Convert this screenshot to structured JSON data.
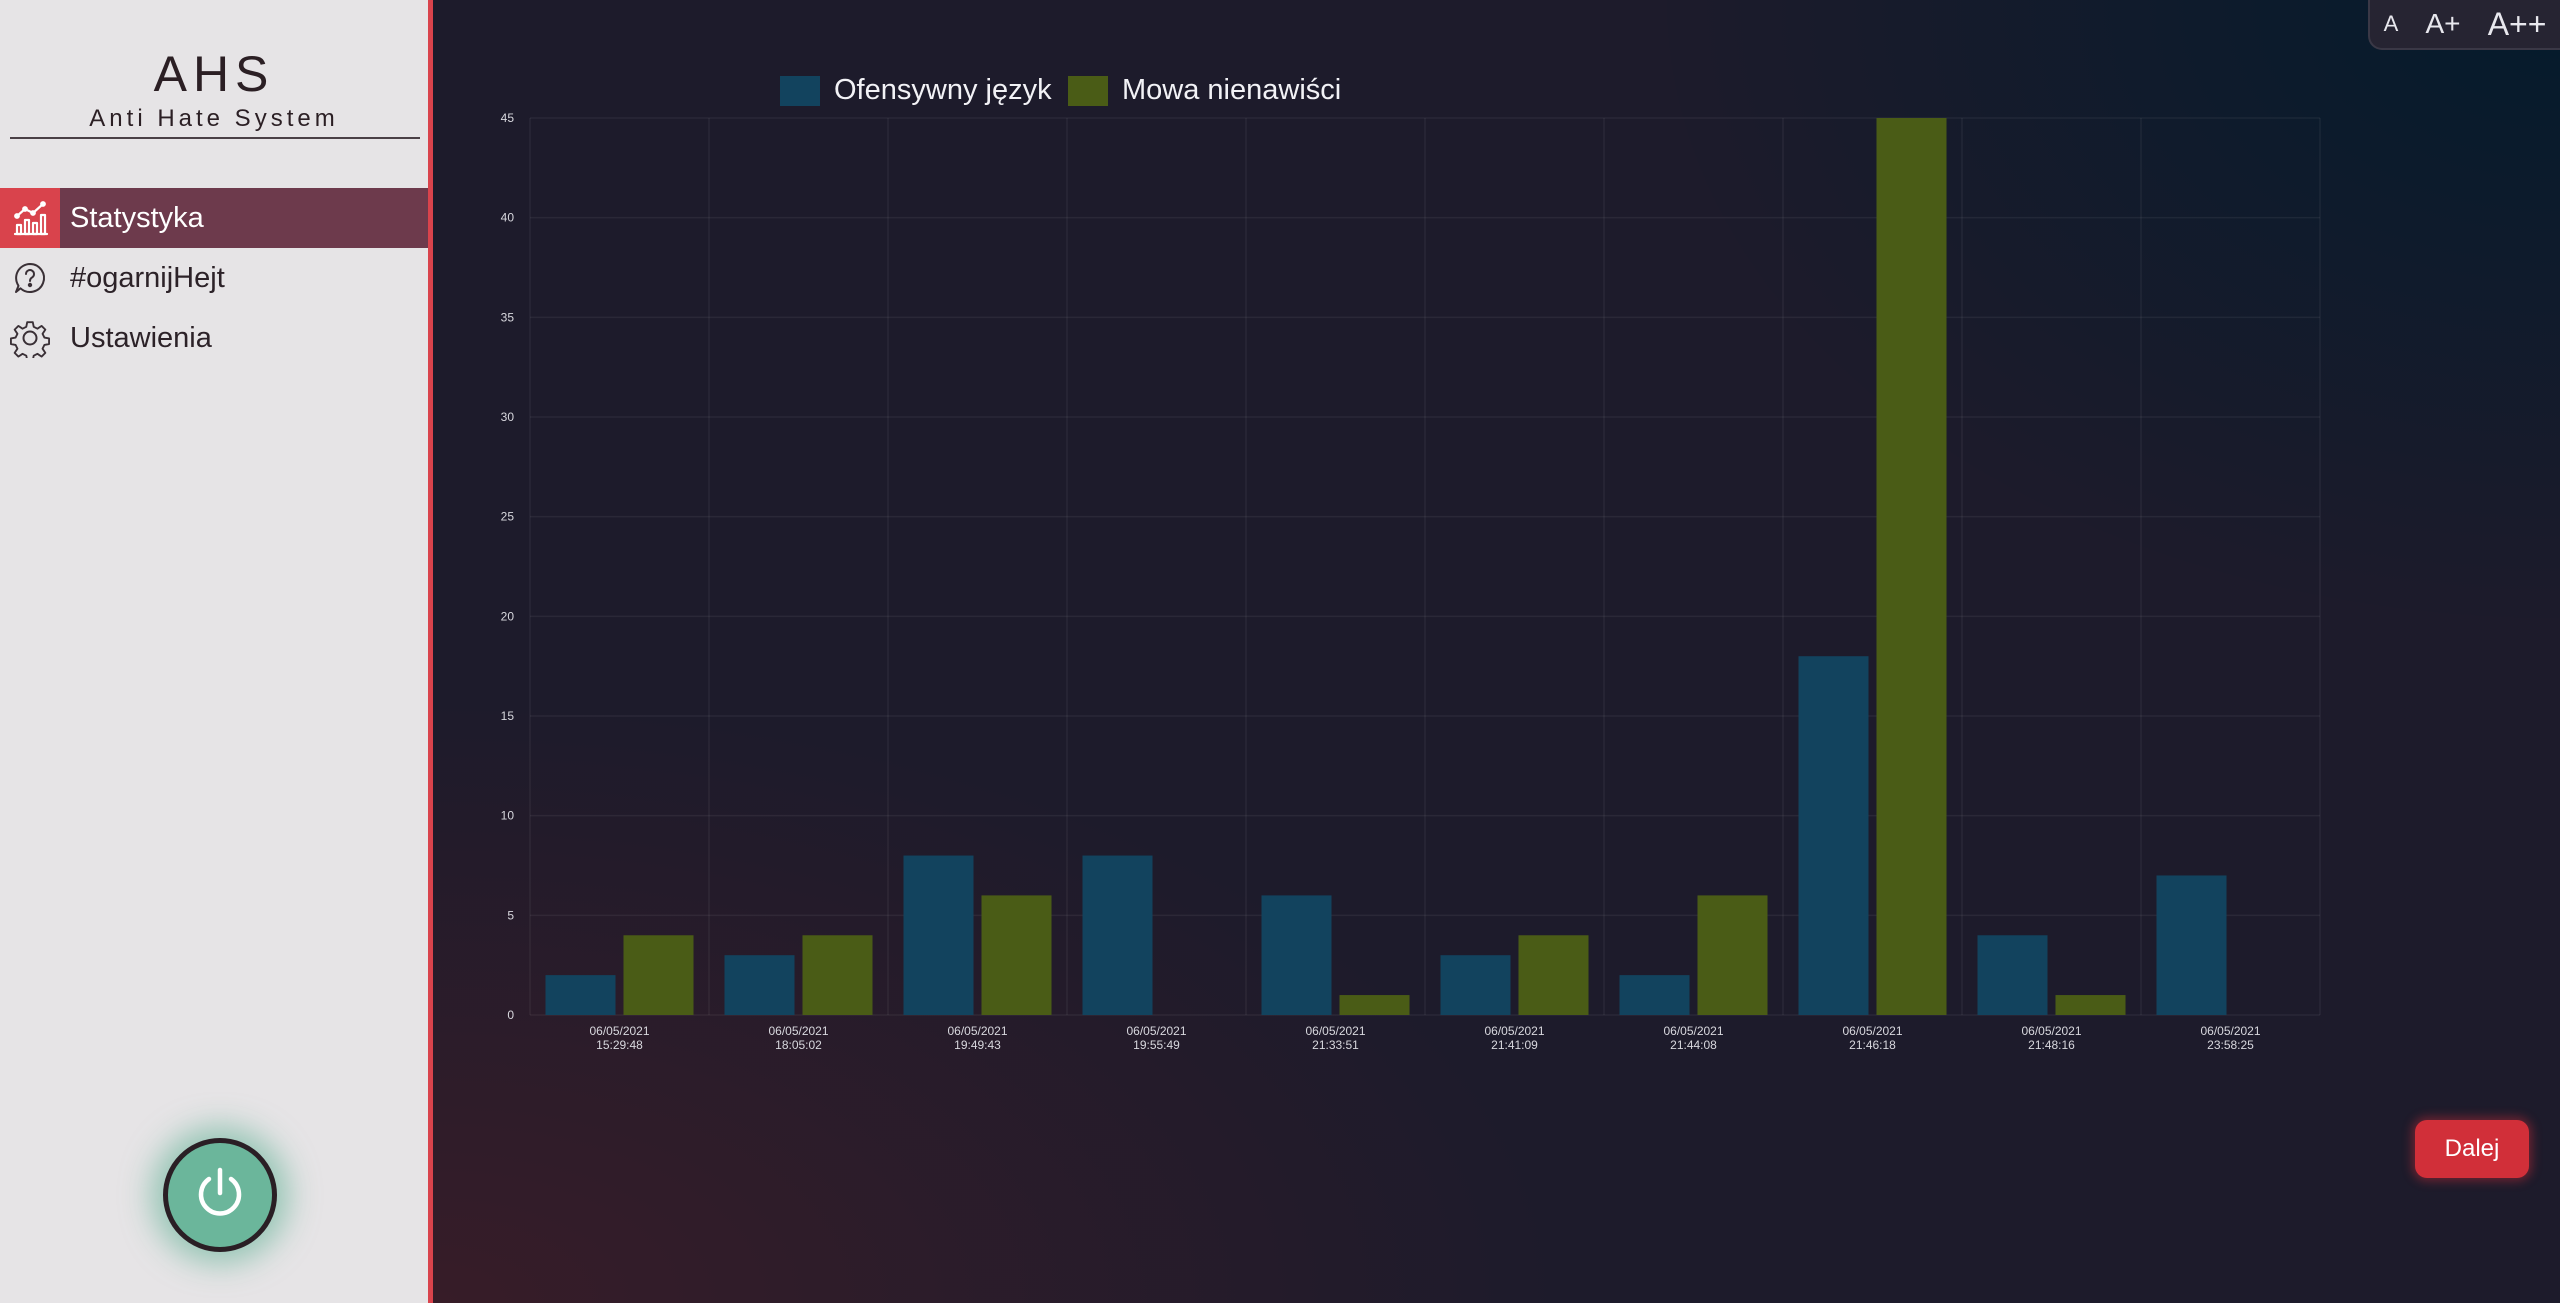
{
  "sidebar": {
    "logo_title": "AHS",
    "logo_subtitle": "Anti Hate System",
    "items": [
      {
        "label": "Statystyka",
        "icon": "chart-line-icon",
        "active": true
      },
      {
        "label": "#ogarnijHejt",
        "icon": "question-icon",
        "active": false
      },
      {
        "label": "Ustawienia",
        "icon": "gear-icon",
        "active": false
      }
    ],
    "power_icon": "power-icon"
  },
  "font_size": {
    "small": "A",
    "medium": "A+",
    "large": "A++"
  },
  "next_button": {
    "label": "Dalej"
  },
  "colors": {
    "accent": "#d9434c",
    "series_offensive": "#12435e",
    "series_hate": "#4a5c16",
    "power": "#6bb69b"
  },
  "chart_data": {
    "type": "bar",
    "categories": [
      [
        "06/05/2021",
        "15:29:48"
      ],
      [
        "06/05/2021",
        "18:05:02"
      ],
      [
        "06/05/2021",
        "19:49:43"
      ],
      [
        "06/05/2021",
        "19:55:49"
      ],
      [
        "06/05/2021",
        "21:33:51"
      ],
      [
        "06/05/2021",
        "21:41:09"
      ],
      [
        "06/05/2021",
        "21:44:08"
      ],
      [
        "06/05/2021",
        "21:46:18"
      ],
      [
        "06/05/2021",
        "21:48:16"
      ],
      [
        "06/05/2021",
        "23:58:25"
      ]
    ],
    "series": [
      {
        "name": "Ofensywny język",
        "color": "#12435e",
        "values": [
          2,
          3,
          8,
          8,
          6,
          3,
          2,
          18,
          4,
          7
        ]
      },
      {
        "name": "Mowa nienawiści",
        "color": "#4a5c16",
        "values": [
          4,
          4,
          6,
          0,
          1,
          4,
          6,
          45,
          1,
          0
        ]
      }
    ],
    "ylim": [
      0,
      45
    ],
    "yticks": [
      0,
      5,
      10,
      15,
      20,
      25,
      30,
      35,
      40,
      45
    ],
    "legend": "top",
    "grid": true
  }
}
